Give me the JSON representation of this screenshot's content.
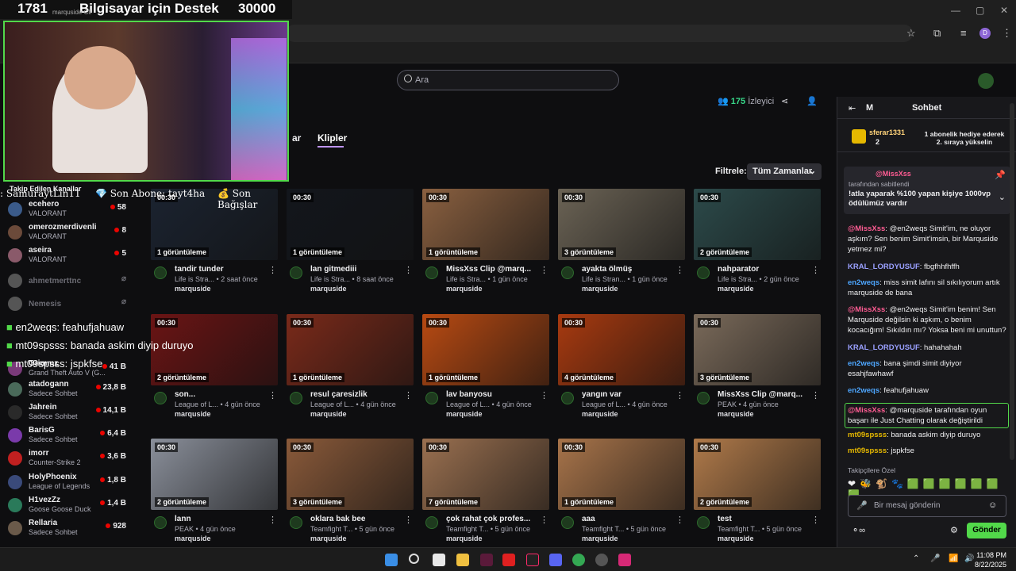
{
  "overlay": {
    "number": "1781",
    "title": "Bilgisayar için Destek",
    "goal": "30000",
    "ticker": [
      ": SamuraytLin11",
      "💎 Son Abone: tayt4ha",
      "💰 Son Bağışlar"
    ],
    "chat": [
      {
        "user": "en2weqs",
        "text": "feahufjahuaw"
      },
      {
        "user": "mt09spsss",
        "text": "banada askim diyip duruyo"
      },
      {
        "user": "mt09spsss",
        "text": "jspkfse"
      }
    ]
  },
  "browser": {
    "tab_text": "marquside Cli"
  },
  "header": {
    "search_placeholder": "Ara",
    "viewers": "175",
    "viewers_label": "İzleyici"
  },
  "tabs": {
    "partial": "ar",
    "active": "Klipler"
  },
  "filter": {
    "label": "Filtrele:",
    "value": "Tüm Zamanlar"
  },
  "sidebar": {
    "heading": "Takip Edilen Kanallar",
    "items": [
      {
        "name": "ecehero",
        "game": "VALORANT",
        "count": "58",
        "live": true
      },
      {
        "name": "omerozmerdivenli",
        "game": "VALORANT",
        "count": "8",
        "live": true
      },
      {
        "name": "aseira",
        "game": "VALORANT",
        "count": "5",
        "live": true
      },
      {
        "name": "ahmetmerttnc",
        "game": "",
        "count": "",
        "live": false
      },
      {
        "name": "Nemesis",
        "game": "",
        "count": "",
        "live": false
      },
      {
        "name": "Grimmz",
        "game": "Grand Theft Auto V (G...",
        "count": "41 B",
        "live": true
      },
      {
        "name": "atadogann",
        "game": "Sadece Sohbet",
        "count": "23,8 B",
        "live": true
      },
      {
        "name": "Jahrein",
        "game": "Sadece Sohbet",
        "count": "14,1 B",
        "live": true
      },
      {
        "name": "BarisG",
        "game": "Sadece Sohbet",
        "count": "6,4 B",
        "live": true
      },
      {
        "name": "imorr",
        "game": "Counter-Strike 2",
        "count": "3,6 B",
        "live": true
      },
      {
        "name": "HolyPhoenix",
        "game": "League of Legends",
        "count": "1,8 B",
        "live": true
      },
      {
        "name": "H1vezZz",
        "game": "Goose Goose Duck",
        "count": "1,4 B",
        "live": true
      },
      {
        "name": "Rellaria",
        "game": "Sadece Sohbet",
        "count": "928",
        "live": true
      }
    ]
  },
  "clips": [
    {
      "duration": "00:30",
      "views": "1 görüntüleme",
      "title": "tandir tunder",
      "game": "Life is Stra...",
      "ago": "2 saat önce",
      "channel": "marquside",
      "bg": "#1b2330"
    },
    {
      "duration": "00:30",
      "views": "1 görüntüleme",
      "title": "lan gitmediii",
      "game": "Life is Stra...",
      "ago": "8 saat önce",
      "channel": "marquside",
      "bg": "#13161c"
    },
    {
      "duration": "00:30",
      "views": "1 görüntüleme",
      "title": "MissXss Clip @marq...",
      "game": "Life is Stra...",
      "ago": "1 gün önce",
      "channel": "marquside",
      "bg": "#8a6040"
    },
    {
      "duration": "00:30",
      "views": "3 görüntüleme",
      "title": "ayakta ölmüş",
      "game": "Life is Stran...",
      "ago": "1 gün önce",
      "channel": "marquside",
      "bg": "#6b6355"
    },
    {
      "duration": "00:30",
      "views": "2 görüntüleme",
      "title": "nahparator",
      "game": "Life is Stra...",
      "ago": "2 gün önce",
      "channel": "marquside",
      "bg": "#2c4a4a"
    },
    {
      "duration": "00:30",
      "views": "2 görüntüleme",
      "title": "son...",
      "game": "League of L...",
      "ago": "4 gün önce",
      "channel": "marquside",
      "bg": "#6b1414"
    },
    {
      "duration": "00:30",
      "views": "1 görüntüleme",
      "title": "resul çaresizlik",
      "game": "League of L...",
      "ago": "4 gün önce",
      "channel": "marquside",
      "bg": "#7a2a1a"
    },
    {
      "duration": "00:30",
      "views": "1 görüntüleme",
      "title": "lav banyosu",
      "game": "League of L...",
      "ago": "4 gün önce",
      "channel": "marquside",
      "bg": "#b84a12"
    },
    {
      "duration": "00:30",
      "views": "4 görüntüleme",
      "title": "yangın var",
      "game": "League of L...",
      "ago": "4 gün önce",
      "channel": "marquside",
      "bg": "#a83a10"
    },
    {
      "duration": "00:30",
      "views": "3 görüntüleme",
      "title": "MissXss Clip @marq...",
      "game": "PEAK",
      "ago": "4 gün önce",
      "channel": "marquside",
      "bg": "#7a6a5a"
    },
    {
      "duration": "00:30",
      "views": "2 görüntüleme",
      "title": "lann",
      "game": "PEAK",
      "ago": "4 gün önce",
      "channel": "marquside",
      "bg": "#8a8f9a"
    },
    {
      "duration": "00:30",
      "views": "3 görüntüleme",
      "title": "oklara bak bee",
      "game": "Teamfight T...",
      "ago": "5 gün önce",
      "channel": "marquside",
      "bg": "#8a5a3a"
    },
    {
      "duration": "00:30",
      "views": "7 görüntüleme",
      "title": "çok rahat çok profes...",
      "game": "Teamfight T...",
      "ago": "5 gün önce",
      "channel": "marquside",
      "bg": "#9a7050"
    },
    {
      "duration": "00:30",
      "views": "1 görüntüleme",
      "title": "aaa",
      "game": "Teamfight T...",
      "ago": "5 gün önce",
      "channel": "marquside",
      "bg": "#a8744a"
    },
    {
      "duration": "00:30",
      "views": "2 görüntüleme",
      "title": "test",
      "game": "Teamfight T...",
      "ago": "5 gün önce",
      "channel": "marquside",
      "bg": "#b07a4a"
    }
  ],
  "chat": {
    "title": "Sohbet",
    "m_label": "M",
    "hype_user": "sferar1331",
    "hype_count": "2",
    "hype_text": "1 abonelik hediye ederek 2. sıraya yükselin",
    "pinned_user": "@MissXss",
    "pinned_by": "tarafından sabitlendi",
    "pinned_text": "!atla yaparak %100 yapan kişiye 1000vp ödülümüz vardır",
    "messages": [
      {
        "user": "@MissXss",
        "text": ": @en2weqs Simit'im, ne oluyor aşkım? Sen benim Simit'imsin, bir Marquside yetmez mi?",
        "color": "#ff5c93"
      },
      {
        "user": "KRAL_LORDYUSUF",
        "text": ": fbgfhhfhffh",
        "color": "#9aa0ff"
      },
      {
        "user": "en2weqs",
        "text": ": miss simit lafını sil sıkılıyorum artık marquside de bana",
        "color": "#4da6ff"
      },
      {
        "user": "@MissXss",
        "text": ": @en2weqs Simit'im benim! Sen Marquside değilsin ki aşkım, o benim kocacığım! Sıkıldın mı? Yoksa beni mi unuttun?",
        "color": "#ff5c93"
      },
      {
        "user": "KRAL_LORDYUSUF",
        "text": ": hahahahah",
        "color": "#9aa0ff"
      },
      {
        "user": "en2weqs",
        "text": ": bana şimdi simit diyiyor esahjfawhawf",
        "color": "#4da6ff"
      },
      {
        "user": "en2weqs",
        "text": ": feahufjahuaw",
        "color": "#4da6ff"
      },
      {
        "user": "@MissXss",
        "text": ": @marquside tarafından oyun başarı ile Just Chatting olarak değiştirildi",
        "color": "#ff5c93"
      },
      {
        "user": "mt09spsss",
        "text": ": banada askim diyip duruyo",
        "color": "#e6b800"
      },
      {
        "user": "mt09spsss",
        "text": ": jspkfse",
        "color": "#e6b800"
      }
    ],
    "followers_label": "Takipçilere Özel",
    "input_placeholder": "Bir mesaj gönderin",
    "send_label": "Gönder"
  },
  "taskbar": {
    "time": "11:08 PM",
    "date": "8/22/2025"
  }
}
